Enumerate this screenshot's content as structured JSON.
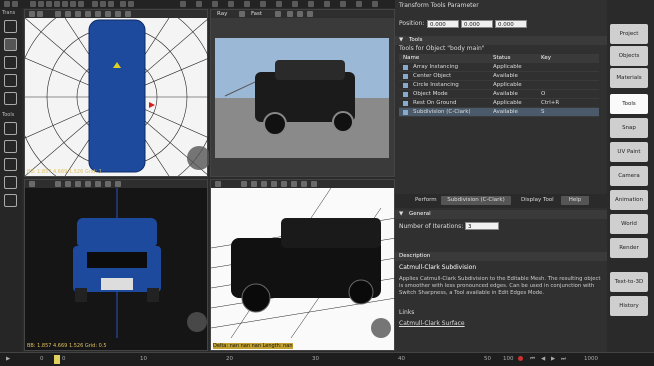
{
  "app": {
    "panel_title": "Transform Tools Parameter"
  },
  "left_toolbar": {
    "trans_label": "Trans",
    "tools_label": "Tools"
  },
  "viewports": {
    "top_header": {
      "ray_label": "Ray",
      "fast_label": "Fast"
    },
    "tl_foot": "BB: 1.857 4.669 1.526  Grid: 1",
    "bl_foot": "BB: 1.857 4.669 1.526  Grid: 0.5",
    "br_foot": "Delta: nan nan nan  Length: nan"
  },
  "panel": {
    "position_label": "Position:",
    "pos_x": "0.000",
    "pos_y": "0.000",
    "pos_z": "0.000",
    "tools_section": "Tools",
    "tools_for": "Tools for Object \"body main\"",
    "col_name": "Name",
    "col_status": "Status",
    "col_key": "Key",
    "rows": [
      {
        "name": "Array Instancing",
        "status": "Applicable",
        "key": ""
      },
      {
        "name": "Center Object",
        "status": "Available",
        "key": ""
      },
      {
        "name": "Circle Instancing",
        "status": "Applicable",
        "key": ""
      },
      {
        "name": "Object Mode",
        "status": "Available",
        "key": "O"
      },
      {
        "name": "Rest On Ground",
        "status": "Applicable",
        "key": "Ctrl+R"
      },
      {
        "name": "Subdivision (C-Clark)",
        "status": "Available",
        "key": "S"
      }
    ],
    "perform_label": "Perform",
    "perform_value": "Subdivision (C-Clark)",
    "display_tool": "Display Tool",
    "help": "Help",
    "general": "General",
    "iterations_label": "Number of Iterations:",
    "iterations_value": "3",
    "description_label": "Description",
    "desc_title": "Catmull-Clark Subdivision",
    "desc_body": "Applies Catmull-Clark Subdivision to the Editable Mesh. The resulting object is smoother with less pronounced edges. Can be used in conjunction with Switch Sharpness, a Tool available in Edit Edges Mode.",
    "links_label": "Links",
    "link_text": "Catmull-Clark Surface"
  },
  "right_buttons": [
    "Project",
    "Objects",
    "Materials",
    "Tools",
    "Snap",
    "UV Paint",
    "Camera",
    "Animation",
    "World",
    "Render",
    "Text-to-3D",
    "History"
  ],
  "timeline": {
    "t0": "0",
    "t1": "0",
    "t10": "10",
    "t20": "20",
    "t30": "30",
    "t40": "40",
    "t50": "50",
    "fps": "100",
    "end": "1000"
  }
}
